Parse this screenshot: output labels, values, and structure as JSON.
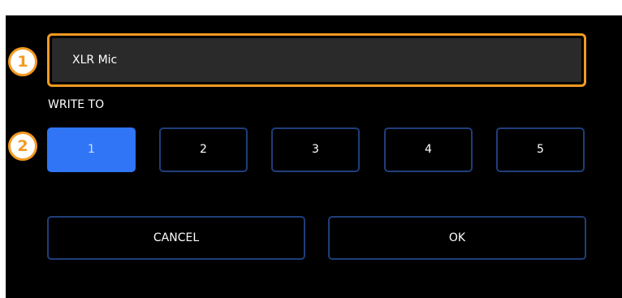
{
  "name_field": {
    "value": "XLR Mic"
  },
  "callouts": [
    "1",
    "2"
  ],
  "write_to": {
    "label": "WRITE TO",
    "slots": [
      "1",
      "2",
      "3",
      "4",
      "5"
    ],
    "selected": "1"
  },
  "actions": {
    "cancel_label": "CANCEL",
    "ok_label": "OK"
  },
  "colors": {
    "highlight": "#f39a21",
    "accent": "#2f75f6",
    "button_border": "#1f3e7a",
    "panel_bg": "#000000",
    "field_bg": "#2a2a2a"
  }
}
